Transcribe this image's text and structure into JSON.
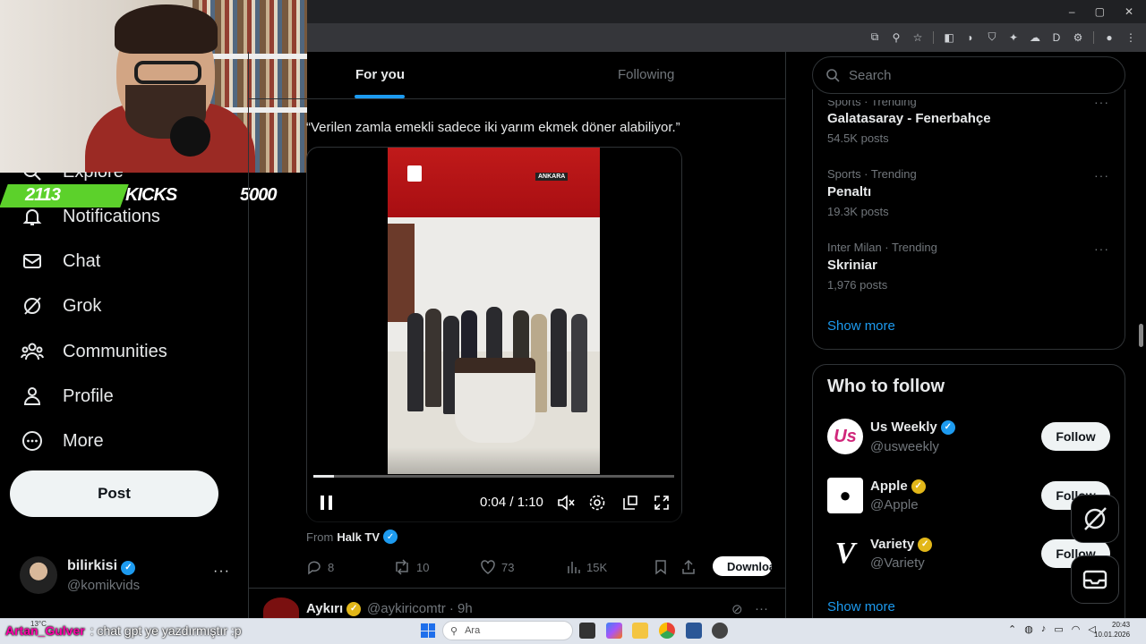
{
  "window": {
    "controls": [
      "–",
      "▢",
      "✕"
    ]
  },
  "overlay": {
    "kick_count": "2113",
    "kick_label": "KICKS",
    "kick_goal": "5000"
  },
  "nav": {
    "items": [
      {
        "label": "Explore",
        "icon": "search-icon"
      },
      {
        "label": "Notifications",
        "icon": "bell-icon"
      },
      {
        "label": "Chat",
        "icon": "mail-icon"
      },
      {
        "label": "Grok",
        "icon": "grok-icon"
      },
      {
        "label": "Communities",
        "icon": "people-icon"
      },
      {
        "label": "Profile",
        "icon": "person-icon"
      },
      {
        "label": "More",
        "icon": "more-circle-icon"
      }
    ],
    "post_label": "Post",
    "profile": {
      "name": "bilirkisi",
      "handle": "@komikvids",
      "more": "···"
    }
  },
  "main": {
    "tabs": [
      {
        "label": "For you"
      },
      {
        "label": "Following"
      }
    ],
    "tweet": {
      "text": "“Verilen zamla emekli sadece iki yarım ekmek döner alabiliyor.”",
      "video": {
        "channel_tag": "ANKARA",
        "time": "0:04 / 1:10",
        "progress": 0.057
      },
      "from_prefix": "From",
      "from_source": "Halk TV",
      "actions": {
        "replies": "8",
        "reposts": "10",
        "likes": "73",
        "views": "15K",
        "download_label": "Download"
      }
    },
    "next_tweet": {
      "name": "Aykırı",
      "handle": "@aykiricomtr · 9h"
    }
  },
  "sidebar": {
    "search_placeholder": "Search",
    "trends": [
      {
        "meta": "Sports · Trending",
        "title": "Galatasaray - Fenerbahçe",
        "posts": "54.5K posts"
      },
      {
        "meta": "Sports · Trending",
        "title": "Penaltı",
        "posts": "19.3K posts"
      },
      {
        "meta": "Inter Milan · Trending",
        "title": "Skriniar",
        "posts": "1,976 posts"
      }
    ],
    "show_more": "Show more",
    "who_to_follow": {
      "title": "Who to follow",
      "accounts": [
        {
          "name": "Us Weekly",
          "handle": "@usweekly",
          "badge": "blue"
        },
        {
          "name": "Apple",
          "handle": "@Apple",
          "badge": "gold"
        },
        {
          "name": "Variety",
          "handle": "@Variety",
          "badge": "gold"
        }
      ],
      "follow_label": "Follow",
      "show_more": "Show more"
    }
  },
  "taskbar": {
    "chat_user": "Artan_Gulver",
    "chat_message": ": chat gpt ye yazdırmıştır :p",
    "weather": "13°C",
    "search_placeholder": "Ara",
    "time": "20:43",
    "date": "10.01.2026"
  },
  "colors": {
    "accent": "#1d9bf0",
    "kick_green": "#5cd12b",
    "gold_badge": "#e2b719"
  }
}
